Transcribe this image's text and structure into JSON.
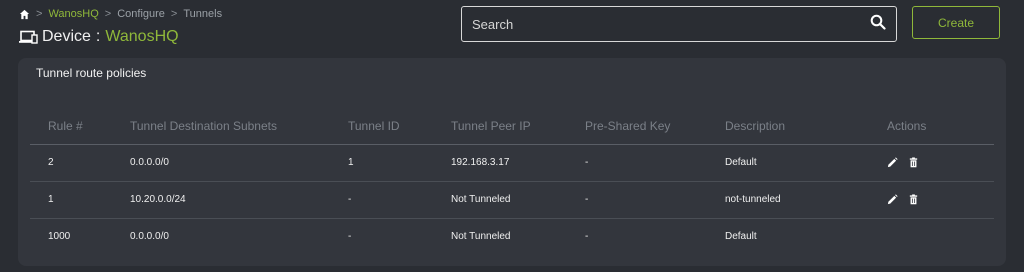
{
  "breadcrumb": {
    "items": [
      "WanosHQ",
      "Configure",
      "Tunnels"
    ],
    "separator": ">"
  },
  "device": {
    "label": "Device",
    "name": "WanosHQ"
  },
  "search": {
    "placeholder": "Search"
  },
  "toolbar": {
    "create_label": "Create"
  },
  "panel": {
    "title": "Tunnel route policies"
  },
  "table": {
    "columns": [
      "Rule #",
      "Tunnel Destination Subnets",
      "Tunnel ID",
      "Tunnel Peer IP",
      "Pre-Shared Key",
      "Description",
      "Actions"
    ],
    "rows": [
      {
        "rule": "2",
        "dest": "0.0.0.0/0",
        "tid": "1",
        "peer": "192.168.3.17",
        "psk": "-",
        "desc": "Default",
        "actions": true
      },
      {
        "rule": "1",
        "dest": "10.20.0.0/24",
        "tid": "-",
        "peer": "Not Tunneled",
        "psk": "-",
        "desc": "not-tunneled",
        "actions": true
      },
      {
        "rule": "1000",
        "dest": "0.0.0.0/0",
        "tid": "-",
        "peer": "Not Tunneled",
        "psk": "-",
        "desc": "Default",
        "actions": false
      }
    ]
  },
  "colors": {
    "accent": "#8fb83a",
    "background": "#2a2d33",
    "panel": "#33363d"
  },
  "icons": [
    "home-icon",
    "device-icon",
    "search-icon",
    "edit-icon",
    "delete-icon"
  ]
}
